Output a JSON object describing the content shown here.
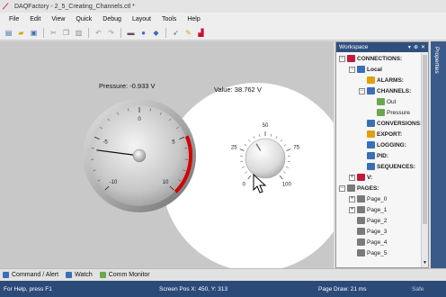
{
  "window": {
    "title": "DAQFactory - 2_5_Creating_Channels.ctl *"
  },
  "menu": [
    "File",
    "Edit",
    "View",
    "Quick",
    "Debug",
    "Layout",
    "Tools",
    "Help"
  ],
  "toolbar": {
    "icons": [
      "new-file-icon",
      "open-folder-icon",
      "save-icon",
      "cut-icon",
      "copy-icon",
      "paste-icon",
      "undo-icon",
      "redo-icon",
      "print-icon",
      "help-icon",
      "info-icon",
      "select-tool-icon",
      "edit-tool-icon",
      "chart-tool-icon"
    ]
  },
  "page": {
    "pressure_label": "Pressure: -0.933 V",
    "value_label": "Value: 38.762 V",
    "gauge": {
      "min": -10,
      "max": 10,
      "value": -0.933,
      "tick_labels": [
        "-10",
        "-5",
        "0",
        "5",
        "10"
      ]
    },
    "knob": {
      "min": 0,
      "max": 100,
      "value": 38.762,
      "tick_labels": [
        "0",
        "25",
        "50",
        "75",
        "100"
      ]
    }
  },
  "workspace": {
    "title": "Workspace",
    "header_buttons": [
      "▾",
      "⊕",
      "✕"
    ],
    "tree": [
      {
        "label": "CONNECTIONS:",
        "depth": 0,
        "exp": "−",
        "bold": true,
        "icon": "connection-icon",
        "color": "#c21a3a"
      },
      {
        "label": "Local",
        "depth": 1,
        "exp": "−",
        "bold": true,
        "icon": "local-connection-icon",
        "color": "#3a6fb5"
      },
      {
        "label": "ALARMS:",
        "depth": 2,
        "exp": "",
        "bold": true,
        "icon": "alarm-icon",
        "color": "#e0a010"
      },
      {
        "label": "CHANNELS:",
        "depth": 2,
        "exp": "−",
        "bold": true,
        "icon": "channels-icon",
        "color": "#3a6fb5"
      },
      {
        "label": "Out",
        "depth": 3,
        "exp": "",
        "bold": false,
        "icon": "channel-icon",
        "color": "#6aa84f"
      },
      {
        "label": "Pressure",
        "depth": 3,
        "exp": "",
        "bold": false,
        "icon": "channel-icon",
        "color": "#6aa84f"
      },
      {
        "label": "CONVERSIONS:",
        "depth": 2,
        "exp": "",
        "bold": true,
        "icon": "conversion-icon",
        "color": "#3a6fb5"
      },
      {
        "label": "EXPORT:",
        "depth": 2,
        "exp": "",
        "bold": true,
        "icon": "export-icon",
        "color": "#e0a010"
      },
      {
        "label": "LOGGING:",
        "depth": 2,
        "exp": "",
        "bold": true,
        "icon": "logging-icon",
        "color": "#3a6fb5"
      },
      {
        "label": "PID:",
        "depth": 2,
        "exp": "",
        "bold": true,
        "icon": "pid-icon",
        "color": "#3a6fb5"
      },
      {
        "label": "SEQUENCES:",
        "depth": 2,
        "exp": "",
        "bold": true,
        "icon": "sequence-icon",
        "color": "#3a6fb5"
      },
      {
        "label": "V:",
        "depth": 1,
        "exp": "+",
        "bold": true,
        "icon": "variable-icon",
        "color": "#c21a3a"
      },
      {
        "label": "PAGES:",
        "depth": 0,
        "exp": "−",
        "bold": true,
        "icon": "pages-icon",
        "color": "#7a7a7a"
      },
      {
        "label": "Page_0",
        "depth": 1,
        "exp": "+",
        "bold": false,
        "icon": "page-icon",
        "color": "#7a7a7a"
      },
      {
        "label": "Page_1",
        "depth": 1,
        "exp": "+",
        "bold": false,
        "icon": "page-icon",
        "color": "#7a7a7a"
      },
      {
        "label": "Page_2",
        "depth": 1,
        "exp": "",
        "bold": false,
        "icon": "page-icon",
        "color": "#7a7a7a"
      },
      {
        "label": "Page_3",
        "depth": 1,
        "exp": "",
        "bold": false,
        "icon": "page-icon",
        "color": "#7a7a7a"
      },
      {
        "label": "Page_4",
        "depth": 1,
        "exp": "",
        "bold": false,
        "icon": "page-icon",
        "color": "#7a7a7a"
      },
      {
        "label": "Page_5",
        "depth": 1,
        "exp": "",
        "bold": false,
        "icon": "page-icon",
        "color": "#7a7a7a"
      }
    ]
  },
  "properties_tab": "Properties",
  "dock_tabs": [
    {
      "label": "Command / Alert",
      "icon": "command-icon",
      "color": "#3a6fb5"
    },
    {
      "label": "Watch",
      "icon": "watch-icon",
      "color": "#3a6fb5"
    },
    {
      "label": "Comm Monitor",
      "icon": "comm-monitor-icon",
      "color": "#6aa84f"
    }
  ],
  "status": {
    "help": "For Help, press F1",
    "screen_pos": "Screen Pos X: 450, Y: 313",
    "page_draw": "Page Draw: 21 ms",
    "safe": "Safe"
  },
  "colors": {
    "accent": "#2b4a78",
    "gauge_red": "#d40000",
    "canvas_bg": "#c8c8c8"
  }
}
